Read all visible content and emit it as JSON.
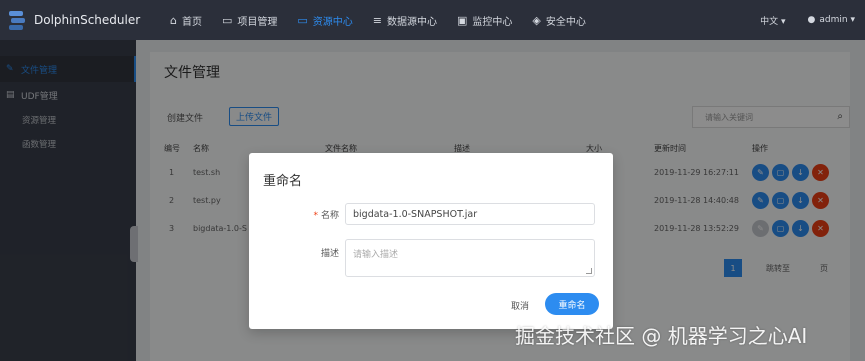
{
  "app": {
    "name": "DolphinScheduler"
  },
  "nav": {
    "items": [
      {
        "label": "首页",
        "icon": "home-icon"
      },
      {
        "label": "项目管理",
        "icon": "folder-icon"
      },
      {
        "label": "资源中心",
        "icon": "folder-icon",
        "active": true
      },
      {
        "label": "数据源中心",
        "icon": "database-icon"
      },
      {
        "label": "监控中心",
        "icon": "monitor-icon"
      },
      {
        "label": "安全中心",
        "icon": "shield-icon"
      }
    ],
    "language": "中文",
    "user": "admin"
  },
  "sidebar": {
    "items": [
      {
        "label": "文件管理",
        "active": true
      },
      {
        "label": "UDF管理"
      }
    ],
    "sub_items": [
      "资源管理",
      "函数管理"
    ]
  },
  "page": {
    "title": "文件管理",
    "create_label": "创建文件",
    "upload_label": "上传文件",
    "search_placeholder": "请输入关键词"
  },
  "table": {
    "columns": [
      "编号",
      "名称",
      "文件名称",
      "描述",
      "大小",
      "更新时间",
      "操作"
    ],
    "rows": [
      {
        "no": "1",
        "name": "test.sh",
        "updated": "2019-11-29 16:27:11"
      },
      {
        "no": "2",
        "name": "test.py",
        "updated": "2019-11-28 14:40:48"
      },
      {
        "no": "3",
        "name": "bigdata-1.0-S",
        "updated": "2019-11-28 13:52:29"
      }
    ]
  },
  "pager": {
    "page": "1",
    "goto_label": "跳转至",
    "page_suffix": "页"
  },
  "modal": {
    "title": "重命名",
    "name_label": "名称",
    "name_value": "bigdata-1.0-SNAPSHOT.jar",
    "desc_label": "描述",
    "desc_placeholder": "请输入描述",
    "cancel_label": "取消",
    "ok_label": "重命名"
  },
  "watermark": "掘金技术社区 @ 机器学习之心AI",
  "colors": {
    "accent": "#2d8cf0",
    "danger": "#ed3f14",
    "topbar": "#2b2f3a",
    "sidebar": "#3a3f4b"
  }
}
